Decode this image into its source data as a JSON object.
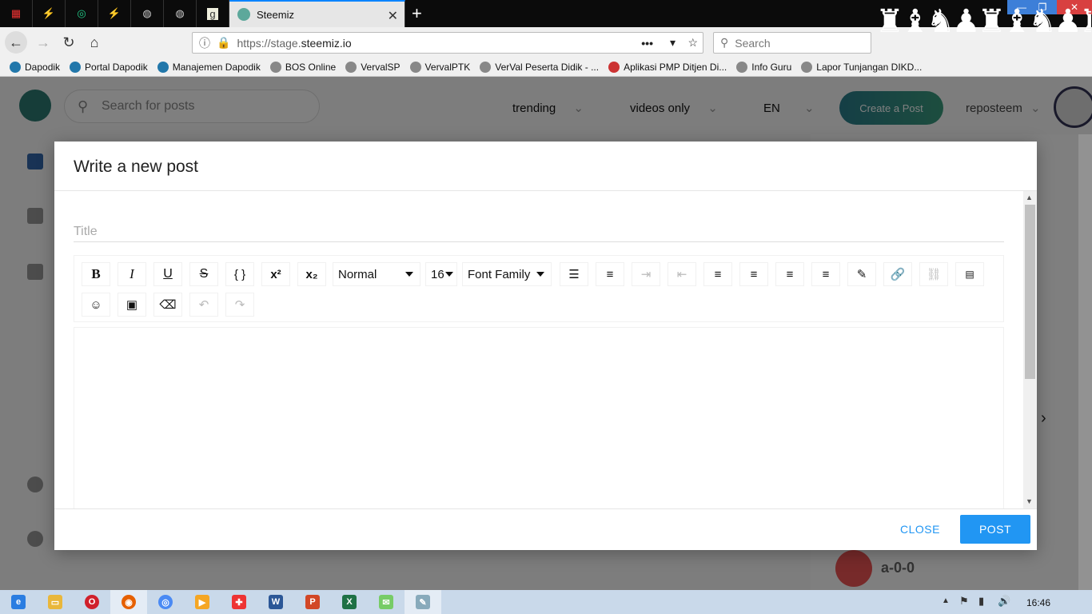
{
  "browser": {
    "active_tab_title": "Steemiz",
    "url_prefix": "https://stage.",
    "url_domain": "steemiz.io",
    "search_placeholder": "Search",
    "bookmarks": [
      "Dapodik",
      "Portal Dapodik",
      "Manajemen Dapodik",
      "BOS Online",
      "VervalSP",
      "VervalPTK",
      "VerVal Peserta Didik - ...",
      "Aplikasi PMP Ditjen Di...",
      "Info Guru",
      "Lapor Tunjangan DIKD..."
    ]
  },
  "page": {
    "search_placeholder": "Search for posts",
    "menu": [
      "trending",
      "videos only",
      "EN"
    ],
    "create_post": "Create a Post",
    "username": "reposteem",
    "sidebar_user": "a-0-0"
  },
  "modal": {
    "title": "Write a new post",
    "title_placeholder": "Title",
    "toolbar": {
      "block_type": "Normal",
      "font_size": "16",
      "font_family": "Font Family"
    },
    "close_label": "CLOSE",
    "post_label": "POST"
  },
  "taskbar": {
    "clock": "16:46"
  }
}
